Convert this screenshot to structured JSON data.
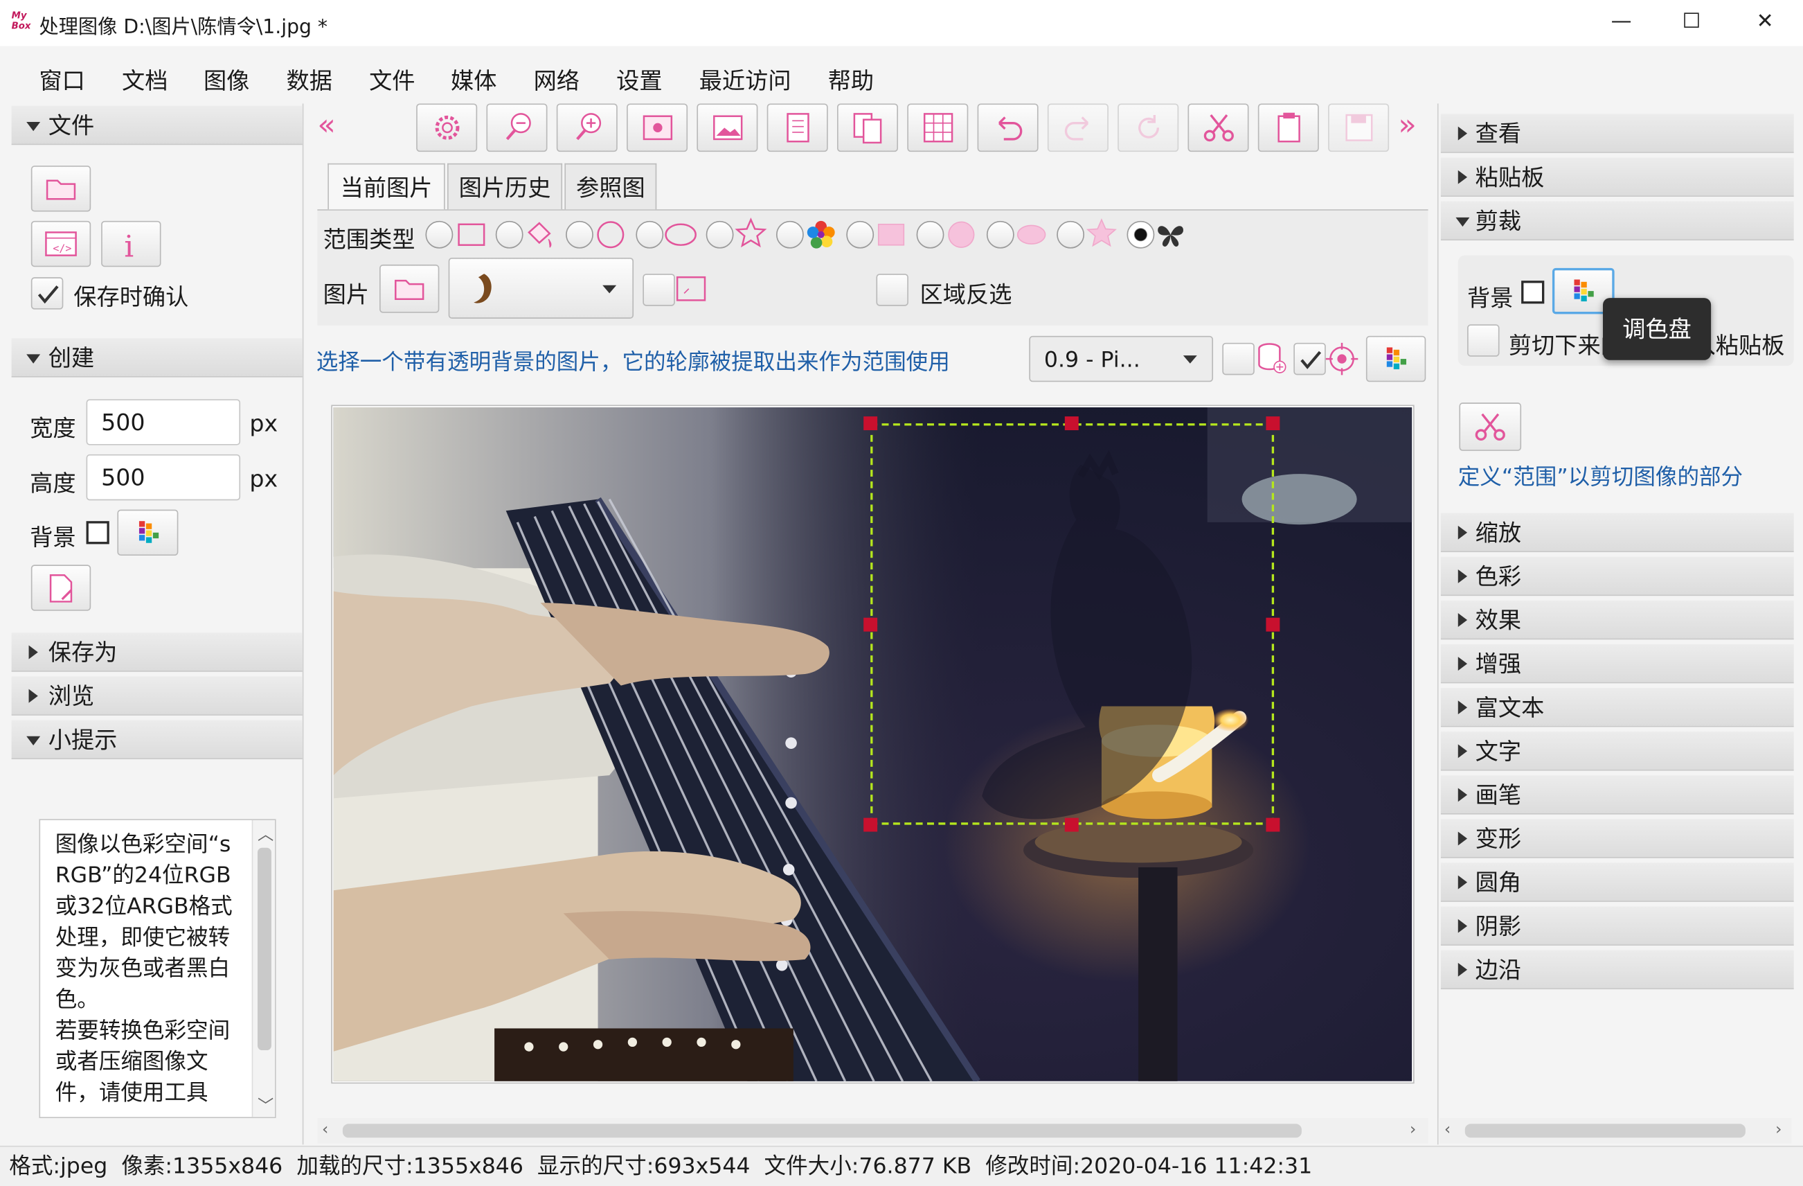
{
  "window": {
    "logo": "My Box",
    "title": "处理图像 D:\\图片\\陈情令\\1.jpg  *",
    "minimize": "—",
    "maximize": "☐",
    "close": "✕"
  },
  "menu": [
    "窗口",
    "文档",
    "图像",
    "数据",
    "文件",
    "媒体",
    "网络",
    "设置",
    "最近访问",
    "帮助"
  ],
  "left": {
    "file_header": "文件",
    "confirm_on_save": "保存时确认",
    "create_header": "创建",
    "width_label": "宽度",
    "width_value": "500",
    "height_label": "高度",
    "height_value": "500",
    "unit": "px",
    "background_label": "背景",
    "save_as_header": "保存为",
    "browse_header": "浏览",
    "tips_header": "小提示",
    "tips_text": "图像以色彩空间“sRGB”的24位RGB或32位ARGB格式处理，即使它被转变为灰色或者黑白色。\n若要转换色彩空间或者压缩图像文件，请使用工具"
  },
  "tabs": [
    "当前图片",
    "图片历史",
    "参照图"
  ],
  "scope": {
    "type_label": "范围类型",
    "image_label": "图片",
    "invert_label": "区域反选",
    "hint": "选择一个带有透明背景的图片，它的轮廓被提取出来作为范围使用",
    "threshold": "0.9 - Pi..."
  },
  "right": {
    "view": "查看",
    "clipboard": "粘贴板",
    "crop": "剪裁",
    "background_label": "背景",
    "cut_to_clipboard": "剪切下来的部分放入粘贴板",
    "tooltip": "调色盘",
    "define_scope": "定义“范围”以剪切图像的部分",
    "sections": [
      "缩放",
      "色彩",
      "效果",
      "增强",
      "富文本",
      "文字",
      "画笔",
      "变形",
      "圆角",
      "阴影",
      "边沿"
    ]
  },
  "status": "格式:jpeg  像素:1355x846  加载的尺寸:1355x846  显示的尺寸:693x544  文件大小:76.877 KB  修改时间:2020-04-16 11:42:31",
  "colors": {
    "accent": "#e2559b",
    "handle": "#c8102e",
    "dash": "#b5e61d",
    "link": "#1f5fa8"
  }
}
